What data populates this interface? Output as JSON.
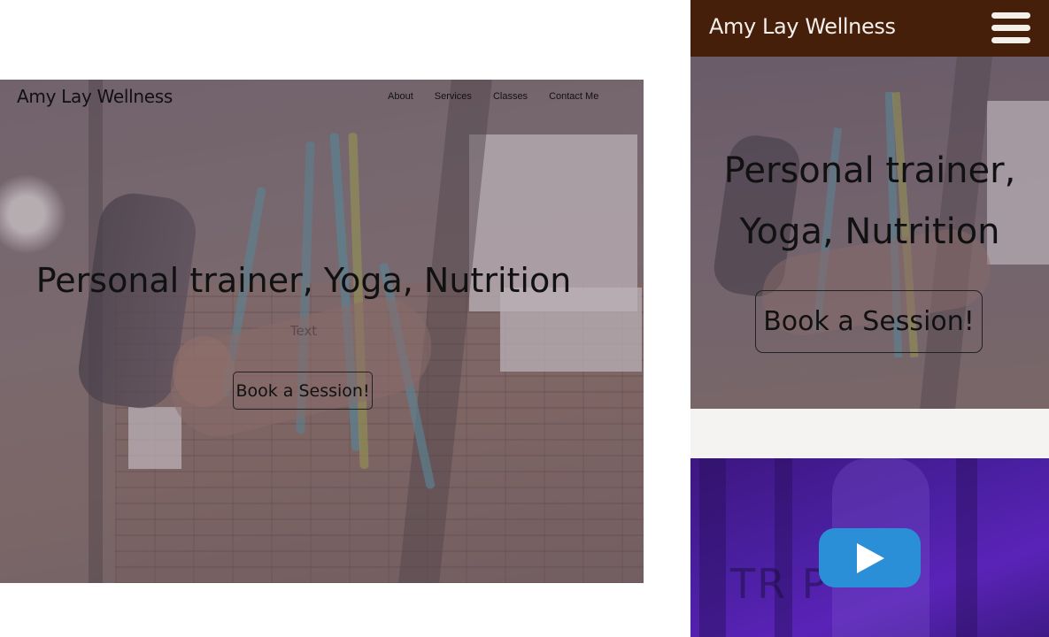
{
  "desktop": {
    "brand": "Amy Lay Wellness",
    "nav": [
      "About",
      "Services",
      "Classes",
      "Contact Me"
    ],
    "headline": "Personal trainer, Yoga, Nutrition",
    "subtext": "Text",
    "cta_label": "Book a Session!"
  },
  "mobile": {
    "brand": "Amy Lay Wellness",
    "headline_line1": "Personal trainer,",
    "headline_line2": "Yoga, Nutrition",
    "cta_label": "Book a Session!",
    "video_background_text": "TR P"
  },
  "colors": {
    "mobile_header": "#461f0b",
    "play_button": "#2a8fd6",
    "video_tint": "#4a1fa0"
  },
  "icons": {
    "menu": "hamburger-icon",
    "play": "play-icon"
  }
}
